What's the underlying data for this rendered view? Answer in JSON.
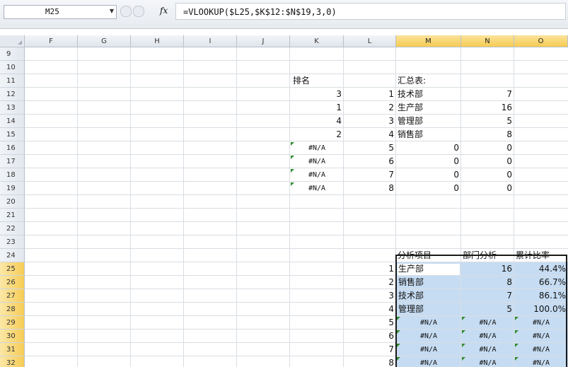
{
  "formula_bar": {
    "name_box": "M25",
    "fx_label": "fx",
    "formula": "=VLOOKUP($L25,$K$12:$N$19,3,0)"
  },
  "columns": [
    "F",
    "G",
    "H",
    "I",
    "J",
    "K",
    "L",
    "M",
    "N",
    "O"
  ],
  "rows": [
    "9",
    "10",
    "11",
    "12",
    "13",
    "14",
    "15",
    "16",
    "17",
    "18",
    "19",
    "20",
    "21",
    "22",
    "23",
    "24",
    "25",
    "26",
    "27",
    "28",
    "29",
    "30",
    "31",
    "32"
  ],
  "upper": {
    "rank_header": "排名",
    "summary_header": "汇总表:",
    "table": [
      {
        "k": "3",
        "l": "1",
        "m": "技术部",
        "n": "7"
      },
      {
        "k": "1",
        "l": "2",
        "m": "生产部",
        "n": "16"
      },
      {
        "k": "4",
        "l": "3",
        "m": "管理部",
        "n": "5"
      },
      {
        "k": "2",
        "l": "4",
        "m": "销售部",
        "n": "8"
      },
      {
        "k": "#N/A",
        "l": "5",
        "m": "0",
        "n": "0"
      },
      {
        "k": "#N/A",
        "l": "6",
        "m": "0",
        "n": "0"
      },
      {
        "k": "#N/A",
        "l": "7",
        "m": "0",
        "n": "0"
      },
      {
        "k": "#N/A",
        "l": "8",
        "m": "0",
        "n": "0"
      }
    ]
  },
  "analysis": {
    "headers": [
      "分析项目",
      "部门分析",
      "累计比率"
    ],
    "rows": [
      {
        "l": "1",
        "m": "生产部",
        "n": "16",
        "o": "44.4%"
      },
      {
        "l": "2",
        "m": "销售部",
        "n": "8",
        "o": "66.7%"
      },
      {
        "l": "3",
        "m": "技术部",
        "n": "7",
        "o": "86.1%"
      },
      {
        "l": "4",
        "m": "管理部",
        "n": "5",
        "o": "100.0%"
      },
      {
        "l": "5",
        "m": "#N/A",
        "n": "#N/A",
        "o": "#N/A"
      },
      {
        "l": "6",
        "m": "#N/A",
        "n": "#N/A",
        "o": "#N/A"
      },
      {
        "l": "7",
        "m": "#N/A",
        "n": "#N/A",
        "o": "#N/A"
      },
      {
        "l": "8",
        "m": "#N/A",
        "n": "#N/A",
        "o": "#N/A"
      }
    ]
  },
  "colors": {
    "selection_fill": "#c6dcf2",
    "header_highlight": "#f6cb52",
    "error_indicator": "#2f8b2f"
  }
}
